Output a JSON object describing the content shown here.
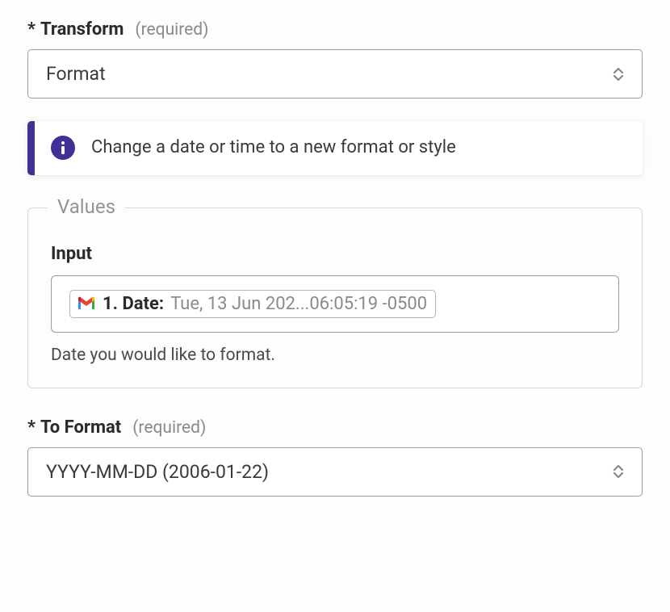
{
  "transform": {
    "label": "Transform",
    "required_tag": "(required)",
    "value": "Format"
  },
  "info": {
    "text": "Change a date or time to a new format or style"
  },
  "values_section": {
    "legend": "Values",
    "input": {
      "label": "Input",
      "token_label": "1. Date:",
      "token_value": "Tue, 13 Jun 202...06:05:19 -0500",
      "help": "Date you would like to format."
    }
  },
  "to_format": {
    "label": "To Format",
    "required_tag": "(required)",
    "value": "YYYY-MM-DD (2006-01-22)"
  }
}
